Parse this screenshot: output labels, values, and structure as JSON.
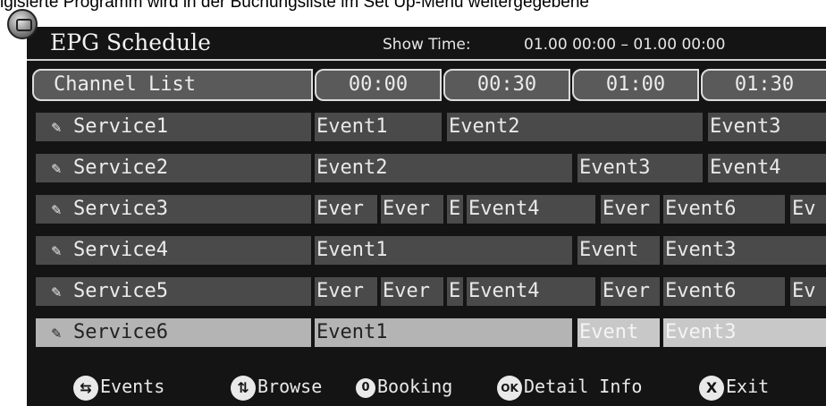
{
  "caption": "igisierte Programm wird in der Buchungsliste im Set Up-Menü weitergegebene",
  "header": {
    "title": "EPG Schedule",
    "show_time_label": "Show Time:",
    "show_time_value": "01.00 00:00 – 01.00 00:00"
  },
  "columns": {
    "channel_list": "Channel List",
    "slots": [
      "00:00",
      "00:30",
      "01:00",
      "01:30"
    ]
  },
  "services": [
    {
      "name": "Service1",
      "events": [
        "Event1",
        "Event2",
        "Event3"
      ]
    },
    {
      "name": "Service2",
      "events": [
        "Event2",
        "Event3",
        "Event4"
      ]
    },
    {
      "name": "Service3",
      "events": [
        "Ever",
        "Ever",
        "E",
        "Event4",
        "Ever",
        "Event6",
        "Ev"
      ]
    },
    {
      "name": "Service4",
      "events": [
        "Event1",
        "Event",
        "Event3"
      ]
    },
    {
      "name": "Service5",
      "events": [
        "Ever",
        "Ever",
        "E",
        "Event4",
        "Ever",
        "Event6",
        "Ev"
      ]
    },
    {
      "name": "Service6",
      "events": [
        "Event1",
        "Event",
        "Event3"
      ]
    }
  ],
  "footer": {
    "events": "Events",
    "browse": "Browse",
    "booking": "Booking",
    "detail_info": "Detail Info",
    "exit": "Exit",
    "booking_key": "0",
    "detail_key": "OK",
    "exit_key": "X"
  },
  "icons": {
    "service": "pencil-icon",
    "events": "swap-arrows-icon",
    "browse": "up-down-arrows-icon"
  },
  "colors": {
    "background": "#141414",
    "cell": "#4a4a4a",
    "selected": "#b4b4b4"
  }
}
